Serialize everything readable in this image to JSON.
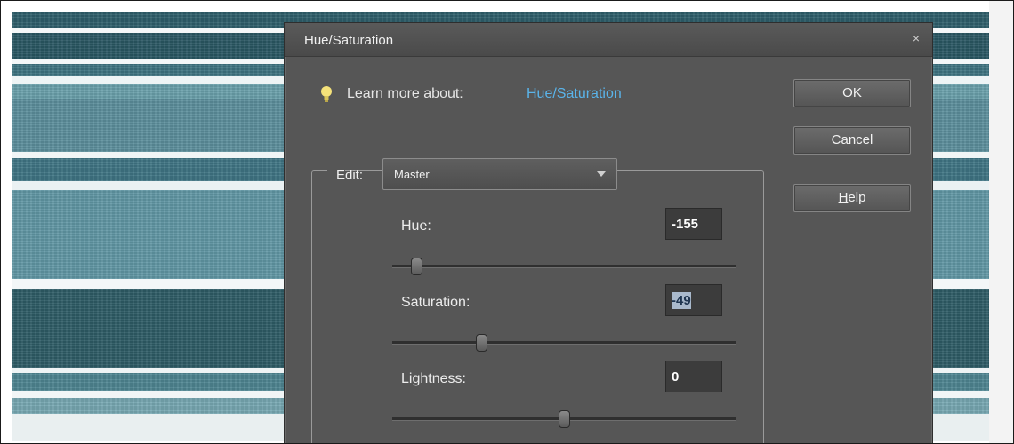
{
  "dialog": {
    "title": "Hue/Saturation",
    "close_glyph": "×",
    "learn_more_label": "Learn more about:",
    "learn_more_link": "Hue/Saturation",
    "buttons": {
      "ok": "OK",
      "cancel": "Cancel",
      "help_prefix": "H",
      "help_rest": "elp"
    },
    "edit": {
      "label": "Edit:",
      "selected": "Master"
    },
    "sliders": {
      "hue": {
        "label": "Hue:",
        "value": "-155",
        "position": 0.07
      },
      "saturation": {
        "label": "Saturation:",
        "value": "-49",
        "position": 0.26,
        "value_selected": true
      },
      "lightness": {
        "label": "Lightness:",
        "value": "0",
        "position": 0.5
      }
    }
  },
  "colors": {
    "dialog_bg": "#565656",
    "link": "#5ab4ea",
    "canvas_teal_dark": "#2e5c66",
    "canvas_teal_mid": "#5c8f9c",
    "canvas_stripe_light": "#eef4f5"
  },
  "icons": {
    "lightbulb": "lightbulb-icon",
    "close": "close-icon",
    "dropdown": "chevron-down-icon"
  }
}
